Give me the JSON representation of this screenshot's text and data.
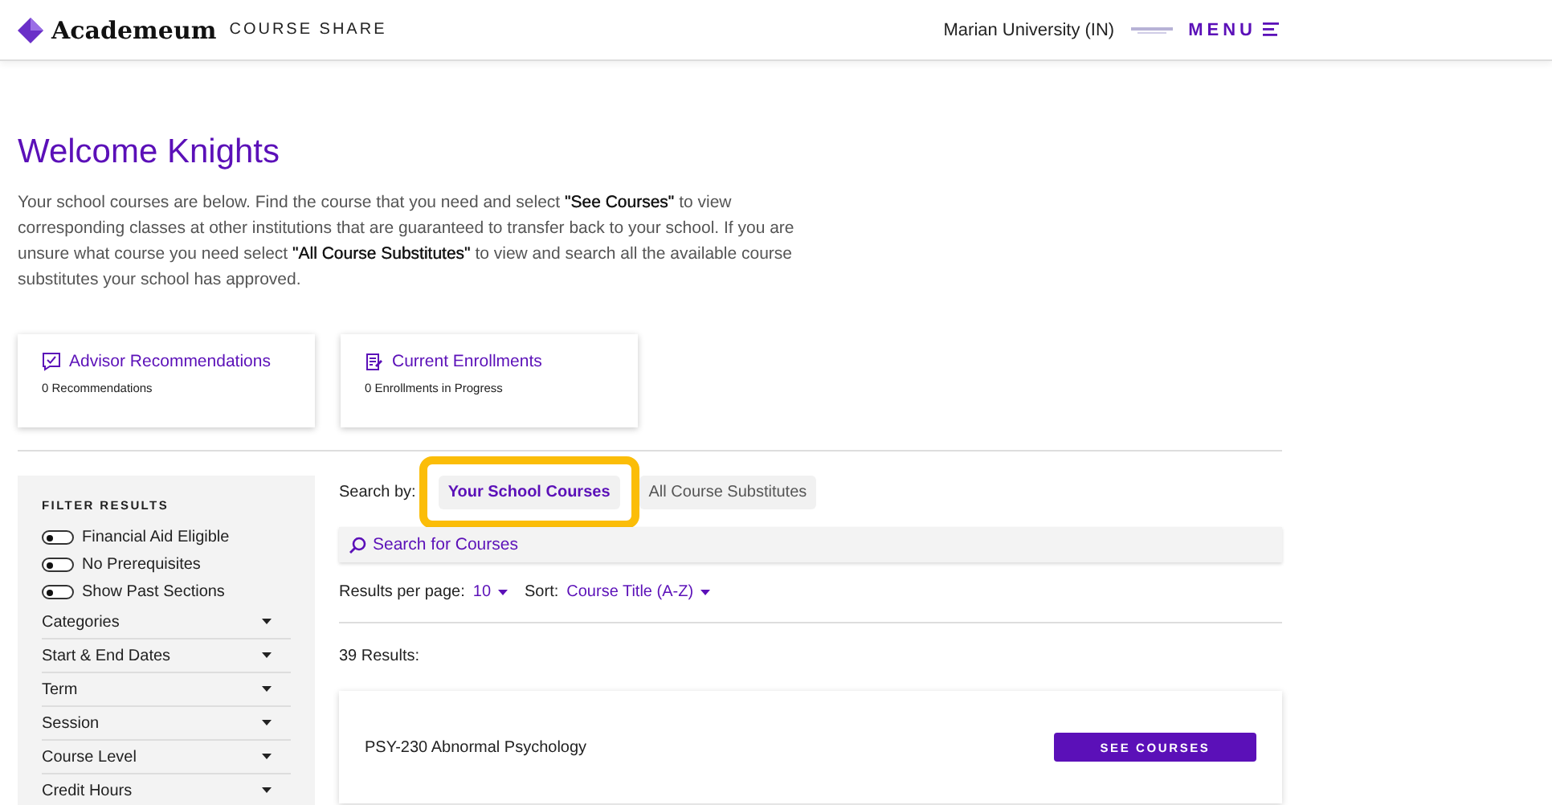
{
  "header": {
    "brand": "Academeum",
    "brand_sub": "COURSE SHARE",
    "school": "Marian University (IN)",
    "menu": "MENU"
  },
  "title": "Welcome Knights",
  "intro": "Your school courses are below. Find the course that you need and select **\"See Courses\"** to view corresponding classes at other institutions that are guaranteed to transfer back to your school. If you are unsure what course you need select **\"All Course Substitutes\"** to view and search all the available course substitutes your school has approved.",
  "cards": [
    {
      "kind": "advisor",
      "title": "Advisor Recommendations",
      "detail": "0 Recommendations"
    },
    {
      "kind": "enrollments",
      "title": "Current Enrollments",
      "detail": "0 Enrollments in Progress"
    }
  ],
  "filters": {
    "heading": "FILTER RESULTS",
    "toggles": [
      {
        "label": "Financial Aid Eligible",
        "on": false
      },
      {
        "label": "No Prerequisites",
        "on": false
      },
      {
        "label": "Show Past Sections",
        "on": false
      }
    ],
    "sections": [
      "Categories",
      "Start & End Dates",
      "Term",
      "Session",
      "Course Level",
      "Credit Hours"
    ]
  },
  "search_by": {
    "label": "Search by:",
    "tabs": [
      {
        "label": "Your School Courses",
        "selected": true,
        "highlighted": true
      },
      {
        "label": "All Course Substitutes",
        "selected": false,
        "highlighted": false
      }
    ]
  },
  "search": {
    "placeholder": "Search for Courses"
  },
  "per_page": {
    "label": "Results per page:",
    "value": "10"
  },
  "sort": {
    "label": "Sort:",
    "value": "Course Title (A-Z)"
  },
  "results_count": "39 Results:",
  "results": [
    {
      "title": "PSY-230 Abnormal Psychology",
      "button": "SEE COURSES"
    }
  ]
}
